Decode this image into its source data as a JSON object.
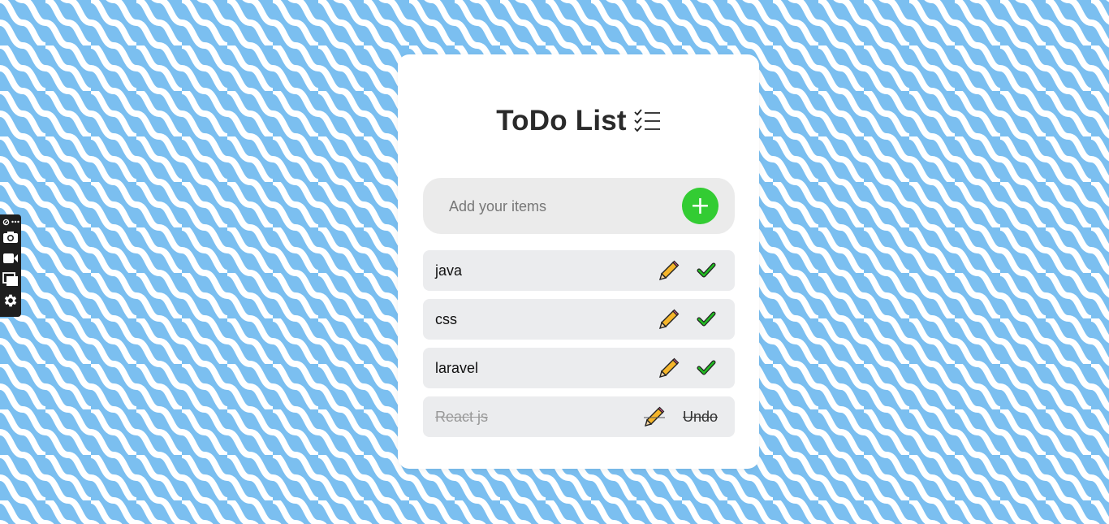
{
  "app": {
    "title": "ToDo List",
    "title_icon": "checklist-icon"
  },
  "colors": {
    "background": "#7bbff0",
    "wave": "#ffffff",
    "card": "#ffffff",
    "add_button": "#33cc33",
    "item_background": "#ebecee",
    "check": "#22bb22",
    "pencil": "#f5b52a"
  },
  "add": {
    "placeholder": "Add your items",
    "value": "",
    "button_label": "+"
  },
  "todos": [
    {
      "text": "java",
      "done": false
    },
    {
      "text": "css",
      "done": false
    },
    {
      "text": "laravel",
      "done": false
    },
    {
      "text": "React js",
      "done": true,
      "undo_label": "Undo"
    }
  ],
  "toolbar": {
    "items": [
      "settings-menu-icon",
      "camera-icon",
      "video-icon",
      "windows-icon",
      "gear-icon"
    ]
  }
}
